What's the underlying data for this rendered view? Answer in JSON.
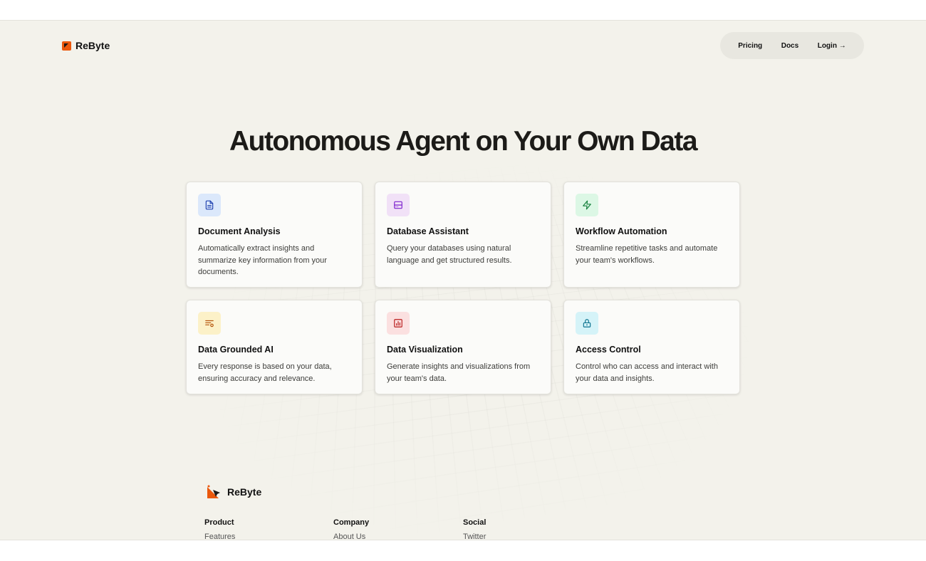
{
  "brand": {
    "name": "ReByte"
  },
  "nav": {
    "items": [
      "Pricing",
      "Docs",
      "Login →"
    ]
  },
  "hero": {
    "title": "Autonomous Agent on Your Own Data"
  },
  "features": [
    {
      "title": "Document Analysis",
      "desc": "Automatically extract insights and summarize key information from your documents.",
      "icon": "document-icon",
      "bg": "#dbe8fb",
      "fg": "#1e40af"
    },
    {
      "title": "Database Assistant",
      "desc": "Query your databases using natural language and get structured results.",
      "icon": "database-icon",
      "bg": "#f1e1f7",
      "fg": "#7e22ce"
    },
    {
      "title": "Workflow Automation",
      "desc": "Streamline repetitive tasks and automate your team's workflows.",
      "icon": "lightning-icon",
      "bg": "#dcf7e5",
      "fg": "#15803d"
    },
    {
      "title": "Data Grounded AI",
      "desc": "Every response is based on your data, ensuring accuracy and relevance.",
      "icon": "list-settings-icon",
      "bg": "#fcf1c8",
      "fg": "#b45309"
    },
    {
      "title": "Data Visualization",
      "desc": "Generate insights and visualizations from your team's data.",
      "icon": "bar-chart-icon",
      "bg": "#fbe0e0",
      "fg": "#b91c1c"
    },
    {
      "title": "Access Control",
      "desc": "Control who can access and interact with your data and insights.",
      "icon": "lock-icon",
      "bg": "#d5f3f8",
      "fg": "#0e7490"
    }
  ],
  "footer": {
    "brand": "ReByte",
    "columns": [
      {
        "heading": "Product",
        "links": [
          "Features"
        ]
      },
      {
        "heading": "Company",
        "links": [
          "About Us"
        ]
      },
      {
        "heading": "Social",
        "links": [
          "Twitter"
        ]
      }
    ]
  }
}
